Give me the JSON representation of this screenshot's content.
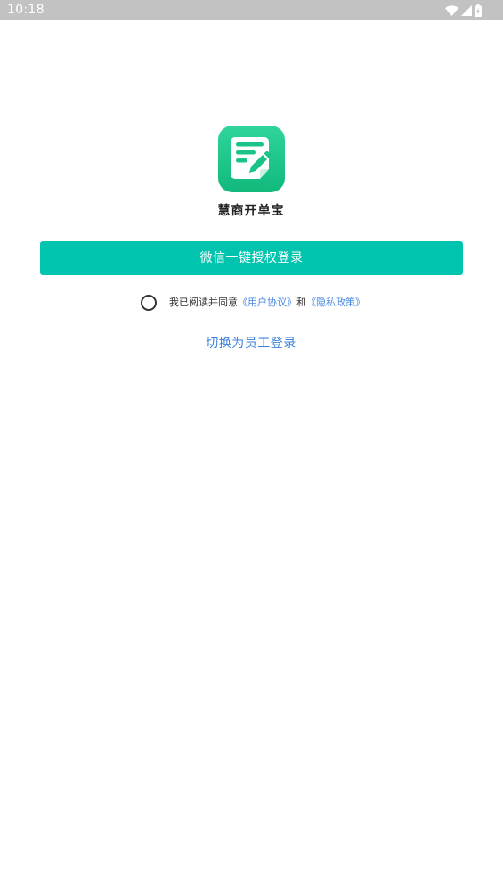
{
  "status_bar": {
    "time": "10:18",
    "icons": [
      "wifi-icon",
      "cellular-signal-icon",
      "battery-icon"
    ]
  },
  "app": {
    "icon": "notepad-pencil-icon",
    "name": "慧商开单宝"
  },
  "login": {
    "wechat_button_label": "微信一键授权登录"
  },
  "agreement": {
    "prefix": "我已阅读并同意",
    "user_agreement": "《用户协议》",
    "conjunction": "和",
    "privacy_policy": "《隐私政策》",
    "checked": false
  },
  "switch_login": {
    "label": "切换为员工登录"
  },
  "colors": {
    "status_bar": "#c2c2c2",
    "primary_button": "#00c4ad",
    "link": "#4a8ae0",
    "app_icon_top": "#2fd59a",
    "app_icon_bottom": "#11b97c"
  }
}
